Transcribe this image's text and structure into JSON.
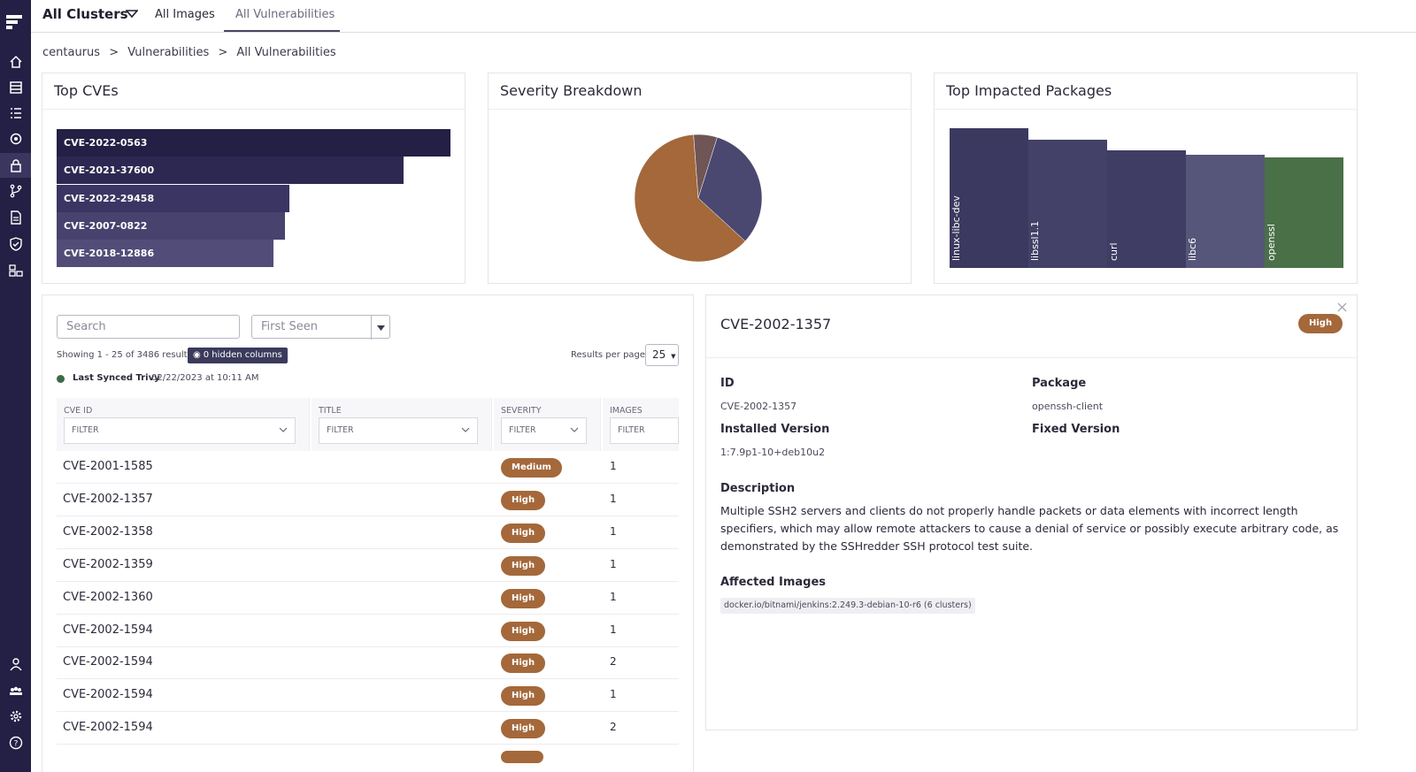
{
  "topbar": {
    "cluster": "All Clusters",
    "tabs": [
      "All Images",
      "All Vulnerabilities"
    ]
  },
  "breadcrumb": [
    "centaurus",
    ">",
    "Vulnerabilities",
    ">",
    "All Vulnerabilities"
  ],
  "cards": {
    "top_cves": {
      "title": "Top CVEs"
    },
    "severity": {
      "title": "Severity Breakdown"
    },
    "packages": {
      "title": "Top Impacted Packages"
    }
  },
  "chart_data": [
    {
      "type": "bar",
      "orientation": "horizontal",
      "categories": [
        "CVE-2022-0563",
        "CVE-2021-37600",
        "CVE-2022-29458",
        "CVE-2007-0822",
        "CVE-2018-12886"
      ],
      "values": [
        100,
        88,
        59,
        58,
        55
      ],
      "colors": [
        "#231f45",
        "#2d2852",
        "#3a3562",
        "#47426e",
        "#524d78"
      ]
    },
    {
      "type": "pie",
      "slices": [
        {
          "value": 62,
          "color": "#a4683a"
        },
        {
          "value": 6,
          "color": "#6f5555"
        },
        {
          "value": 32,
          "color": "#4a4870"
        }
      ]
    },
    {
      "type": "bar",
      "categories": [
        "linux-libc-dev",
        "libssl1.1",
        "curl",
        "libc6",
        "openssl"
      ],
      "values": [
        100,
        92,
        84,
        81,
        79
      ],
      "colors": [
        "#3b395f",
        "#434167",
        "#3f3d63",
        "#56557a",
        "#4a7048"
      ]
    }
  ],
  "table_panel": {
    "search_placeholder": "Search",
    "sort_value": "First Seen",
    "showing": "Showing 1 - 25 of 3486 results",
    "hidden_columns": "0 hidden columns",
    "results_per_page_label": "Results per page",
    "results_per_page": "25",
    "sync_label": "Last Synced Trivy",
    "sync_time": "02/22/2023 at 10:11 AM",
    "columns": [
      {
        "label": "CVE ID",
        "filter": "FILTER"
      },
      {
        "label": "TITLE",
        "filter": "FILTER"
      },
      {
        "label": "SEVERITY",
        "filter": "FILTER"
      },
      {
        "label": "IMAGES",
        "filter": "FILTER"
      }
    ],
    "rows": [
      {
        "id": "CVE-2001-1585",
        "severity": "Medium",
        "images": "1"
      },
      {
        "id": "CVE-2002-1357",
        "severity": "High",
        "images": "1"
      },
      {
        "id": "CVE-2002-1358",
        "severity": "High",
        "images": "1"
      },
      {
        "id": "CVE-2002-1359",
        "severity": "High",
        "images": "1"
      },
      {
        "id": "CVE-2002-1360",
        "severity": "High",
        "images": "1"
      },
      {
        "id": "CVE-2002-1594",
        "severity": "High",
        "images": "1"
      },
      {
        "id": "CVE-2002-1594",
        "severity": "High",
        "images": "2"
      },
      {
        "id": "CVE-2002-1594",
        "severity": "High",
        "images": "1"
      },
      {
        "id": "CVE-2002-1594",
        "severity": "High",
        "images": "2"
      }
    ]
  },
  "detail": {
    "title": "CVE-2002-1357",
    "severity": "High",
    "id_label": "ID",
    "id_value": "CVE-2002-1357",
    "package_label": "Package",
    "package_value": "openssh-client",
    "installed_label": "Installed Version",
    "installed_value": "1:7.9p1-10+deb10u2",
    "fixed_label": "Fixed Version",
    "description_label": "Description",
    "description": "Multiple SSH2 servers and clients do not properly handle packets or data elements with incorrect length specifiers, which may allow remote attackers to cause a denial of service or possibly execute arbitrary code, as demonstrated by the SSHredder SSH protocol test suite.",
    "affected_label": "Affected Images",
    "affected_image": "docker.io/bitnami/jenkins:2.249.3-debian-10-r6 (6 clusters)"
  },
  "sidebar_icons": [
    "home-icon",
    "list-icon",
    "tasks-icon",
    "gear-cog-icon",
    "lock-icon",
    "branch-icon",
    "report-icon",
    "shield-icon",
    "network-icon",
    "user-icon",
    "team-icon",
    "settings-icon",
    "help-icon"
  ]
}
